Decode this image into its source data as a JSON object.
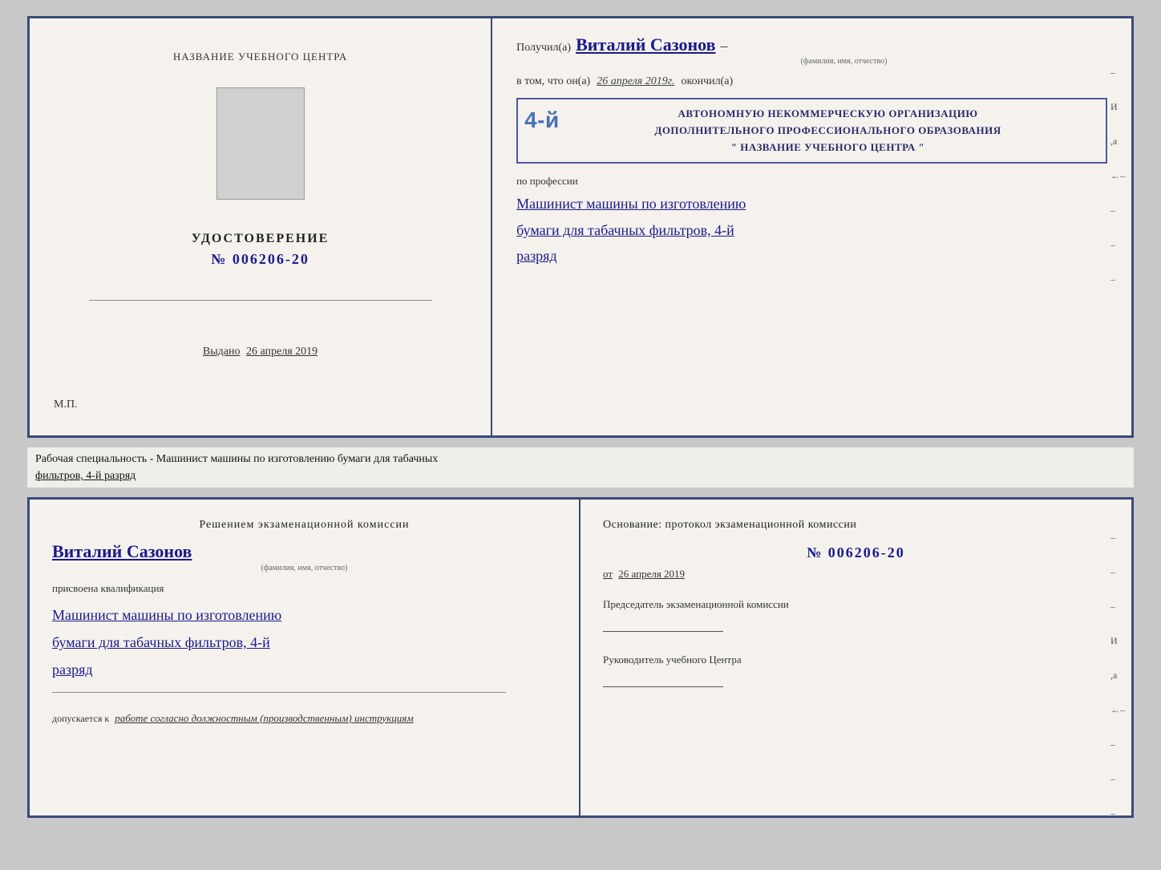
{
  "top_cert": {
    "left": {
      "school_name_label": "НАЗВАНИЕ УЧЕБНОГО ЦЕНТРА",
      "cert_title": "УДОСТОВЕРЕНИЕ",
      "cert_number": "№ 006206-20",
      "issued_label": "Выдано",
      "issued_date": "26 апреля 2019",
      "mp_label": "М.П."
    },
    "right": {
      "received_label": "Получил(а)",
      "recipient_name": "Виталий Сазонов",
      "fio_hint": "(фамилия, имя, отчество)",
      "dash": "–",
      "vtom_label": "в том, что он(а)",
      "vtom_date": "26 апреля 2019г.",
      "finished_label": "окончил(а)",
      "stamp_line1": "АВТОНОМНУЮ НЕКОММЕРЧЕСКУЮ ОРГАНИЗАЦИЮ",
      "stamp_line2": "ДОПОЛНИТЕЛЬНОГО ПРОФЕССИОНАЛЬНОГО ОБРАЗОВАНИЯ",
      "stamp_line3": "\" НАЗВАНИЕ УЧЕБНОГО ЦЕНТРА \"",
      "stamp_number": "4-й",
      "profession_label": "по профессии",
      "profession_name_1": "Машинист машины по изготовлению",
      "profession_name_2": "бумаги для табачных фильтров, 4-й",
      "profession_name_3": "разряд"
    },
    "right_marks": [
      "-",
      "И",
      ",а",
      "←",
      "-",
      "-",
      "-"
    ]
  },
  "specialty_line": {
    "prefix": "Рабочая специальность - Машинист машины по изготовлению бумаги для табачных",
    "suffix": "фильтров, 4-й разряд"
  },
  "bottom_cert": {
    "left": {
      "decision_title": "Решением  экзаменационной  комиссии",
      "person_name": "Виталий Сазонов",
      "fio_hint": "(фамилия, имя, отчество)",
      "qualification_label": "присвоена квалификация",
      "qualification_1": "Машинист машины по изготовлению",
      "qualification_2": "бумаги для табачных фильтров, 4-й",
      "qualification_3": "разряд",
      "допускается_label": "допускается к",
      "допускается_text": "работе согласно должностным (производственным) инструкциям"
    },
    "right": {
      "basis_label": "Основание: протокол экзаменационной  комиссии",
      "basis_number": "№ 006206-20",
      "basis_date_prefix": "от",
      "basis_date": "26 апреля 2019",
      "chairman_label": "Председатель экзаменационной комиссии",
      "head_label": "Руководитель учебного Центра"
    },
    "right_marks": [
      "-",
      "-",
      "-",
      "И",
      ",а",
      "←",
      "-",
      "-",
      "-"
    ]
  }
}
